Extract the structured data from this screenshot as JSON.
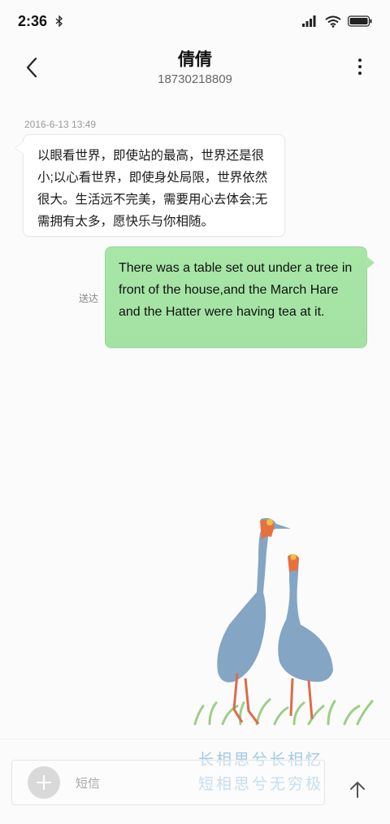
{
  "status_bar": {
    "time": "2:36",
    "icons": [
      "bluetooth-icon",
      "signal-icon",
      "wifi-icon",
      "battery-icon"
    ]
  },
  "header": {
    "contact_name": "倩倩",
    "contact_number": "18730218809",
    "icons": [
      "back-arrow-icon",
      "more-vertical-icon"
    ]
  },
  "messages": [
    {
      "direction": "incoming",
      "timestamp": "2016-6-13 13:49",
      "text": "以眼看世界，即使站的最高，世界还是很小;以心看世界，即使身处局限，世界依然很大。生活远不完美，需要用心去体会;无需拥有太多，愿快乐与你相随。"
    },
    {
      "direction": "outgoing",
      "status": "送达",
      "text": "There was a table set out under a tree in front of the house,and the March Hare and the Hatter were having tea at it."
    }
  ],
  "background": {
    "art": "crane-illustration",
    "poem_line_1": "长相思兮长相忆",
    "poem_line_2": "短相思兮无穷极"
  },
  "composer": {
    "placeholder": "短信",
    "icons": [
      "add-icon",
      "send-arrow-icon"
    ]
  },
  "colors": {
    "outgoing_bubble": "#a8e6a7",
    "incoming_bubble": "#ffffff",
    "poem": "#9ec9e6"
  }
}
